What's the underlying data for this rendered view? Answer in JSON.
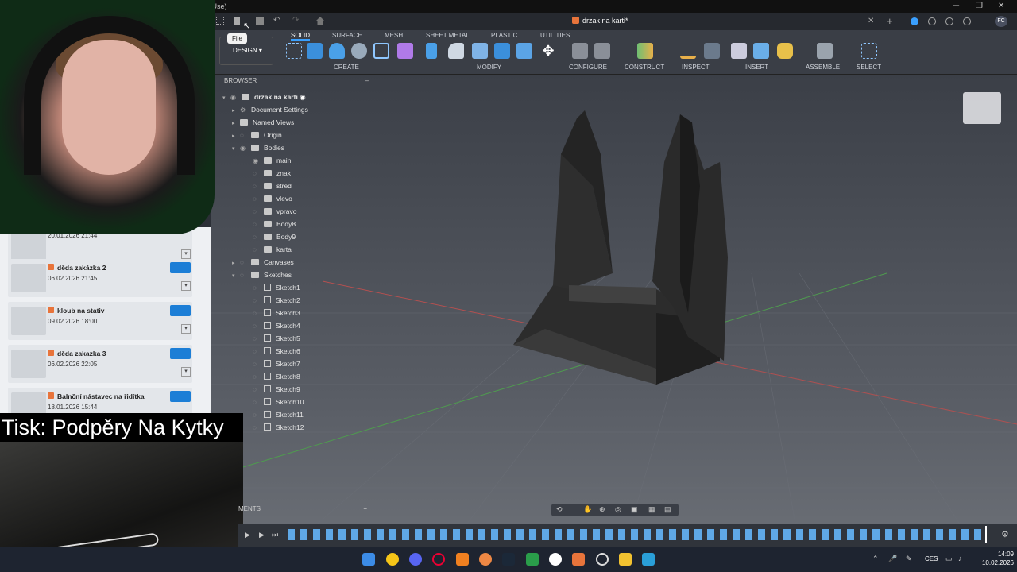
{
  "window": {
    "title_fragment": "l Use)",
    "min": "─",
    "max": "❐",
    "close": "✕"
  },
  "tabs": {
    "doc_title": "drzak na karti*"
  },
  "toolbar": {
    "design_label": "DESIGN",
    "file_tooltip": "File",
    "mode_tabs": [
      "SOLID",
      "SURFACE",
      "MESH",
      "SHEET METAL",
      "PLASTIC",
      "UTILITIES"
    ],
    "groups": [
      "CREATE",
      "MODIFY",
      "CONFIGURE",
      "CONSTRUCT",
      "INSPECT",
      "INSERT",
      "ASSEMBLE",
      "SELECT"
    ]
  },
  "browser": {
    "header": "BROWSER",
    "root": "drzak na karti",
    "items": [
      {
        "label": "Document Settings"
      },
      {
        "label": "Named Views"
      },
      {
        "label": "Origin"
      },
      {
        "label": "Bodies"
      }
    ],
    "bodies": [
      "main",
      "znak",
      "střed",
      "vlevo",
      "vpravo",
      "Body8",
      "Body9",
      "karta"
    ],
    "canvases": "Canvases",
    "sketches_label": "Sketches",
    "sketches": [
      "Sketch1",
      "Sketch2",
      "Sketch3",
      "Sketch4",
      "Sketch5",
      "Sketch6",
      "Sketch7",
      "Sketch8",
      "Sketch9",
      "Sketch10",
      "Sketch11",
      "Sketch12"
    ]
  },
  "data_panel": {
    "cards": [
      {
        "name": "",
        "date": "20.01.2026 21:44"
      },
      {
        "name": "děda zakázka 2",
        "date": "06.02.2026 21:45"
      },
      {
        "name": "kloub na stativ",
        "date": "09.02.2026 18:00"
      },
      {
        "name": "děda zakazka 3",
        "date": "06.02.2026 22:05"
      },
      {
        "name": "Balnční nástavec na řidítka",
        "date": "18.01.2026 15:44"
      }
    ]
  },
  "overlay": {
    "print_caption": "Tisk: Podpěry Na Kytky"
  },
  "comments": {
    "label": "MENTS",
    "plus": "+"
  },
  "taskbar": {
    "lang": "CES",
    "time": "14:09",
    "date": "10.02.2026"
  },
  "colors": {
    "accent": "#3aa0ff",
    "fusion_orange": "#e8743b",
    "viewport_top": "#3b3f47",
    "model": "#2a2a2a"
  }
}
